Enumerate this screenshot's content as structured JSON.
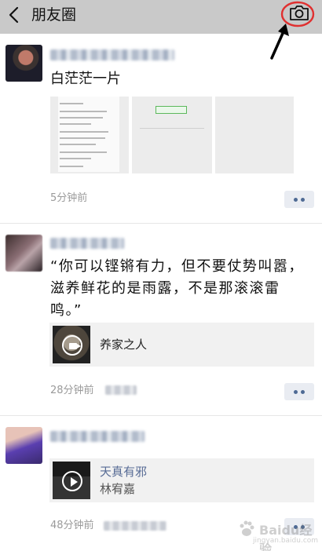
{
  "header": {
    "title": "朋友圈",
    "back_icon": "chevron-left-icon",
    "camera_icon": "camera-icon",
    "background": "#c9c9c9"
  },
  "annotation": {
    "highlight_color": "#e03030",
    "arrow_color": "#000000"
  },
  "posts": [
    {
      "text": "白茫茫一片",
      "time": "5分钟前",
      "image_count": 3
    },
    {
      "text": "“你可以铿锵有力，但不要仗势叫嚣，滋养鲜花的是雨露，不是那滚滚雷鸣。”",
      "time": "28分钟前",
      "share": {
        "type": "video",
        "title": "养家之人"
      }
    },
    {
      "text": "",
      "time": "48分钟前",
      "share": {
        "type": "music",
        "title": "天真有邪",
        "artist": "林宥嘉"
      }
    }
  ],
  "colors": {
    "link_blue": "#576b95",
    "time_gray": "#9a9a9a",
    "card_bg": "#f1f1f1"
  },
  "watermark": {
    "text": "Baidu经验",
    "sub": "jingyan.baidu.com"
  }
}
